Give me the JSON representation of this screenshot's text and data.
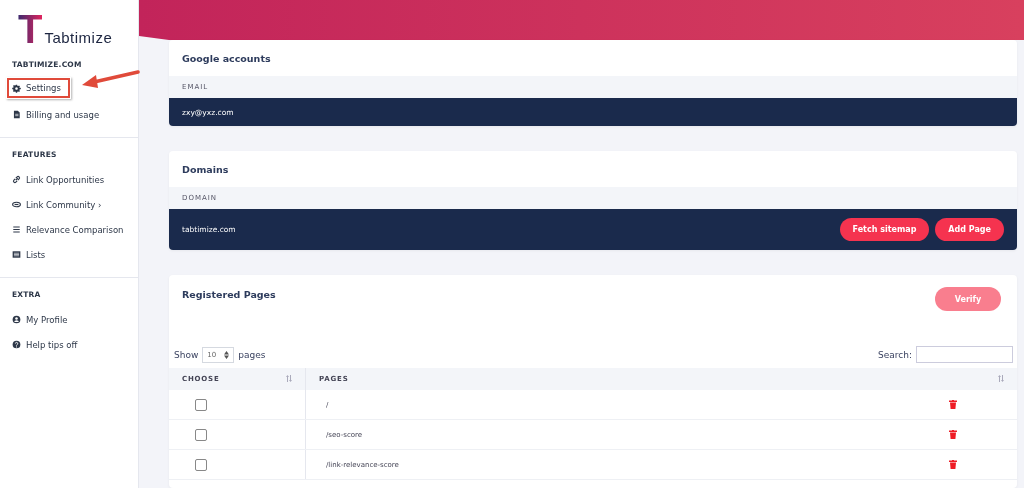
{
  "sidebar": {
    "logo": {
      "letter": "T",
      "text": "Tabtimize"
    },
    "sections": [
      {
        "title": "TABTIMIZE.COM",
        "items": [
          {
            "label": "Settings",
            "kind": "gear",
            "highlighted": true
          },
          {
            "label": "Billing and usage",
            "kind": "doc",
            "highlighted": false
          }
        ]
      },
      {
        "title": "FEATURES",
        "items": [
          {
            "label": "Link Opportunities",
            "kind": "link",
            "highlighted": false
          },
          {
            "label": "Link Community ›",
            "kind": "hands",
            "highlighted": false
          },
          {
            "label": "Relevance Comparison",
            "kind": "bars",
            "highlighted": false
          },
          {
            "label": "Lists",
            "kind": "list",
            "highlighted": false
          }
        ]
      },
      {
        "title": "EXTRA",
        "items": [
          {
            "label": "My Profile",
            "kind": "user",
            "highlighted": false
          },
          {
            "label": "Help tips off",
            "kind": "help",
            "highlighted": false
          }
        ]
      }
    ]
  },
  "google_accounts": {
    "title": "Google accounts",
    "column": "EMAIL",
    "value": "zxy@yxz.com"
  },
  "domains": {
    "title": "Domains",
    "column": "DOMAIN",
    "value": "tabtimize.com",
    "buttons": [
      "Fetch sitemap",
      "Add Page"
    ]
  },
  "registered_pages": {
    "title": "Registered Pages",
    "verify_button": {
      "label": "Verify",
      "disabled": true
    },
    "show_label": "Show",
    "page_size": "10",
    "show_suffix": "pages",
    "search_label": "Search:",
    "columns": [
      "CHOOSE",
      "PAGES"
    ],
    "rows": [
      {
        "page": "/",
        "checked": false
      },
      {
        "page": "/seo-score",
        "checked": false
      },
      {
        "page": "/link-relevance-score",
        "checked": false
      }
    ]
  }
}
